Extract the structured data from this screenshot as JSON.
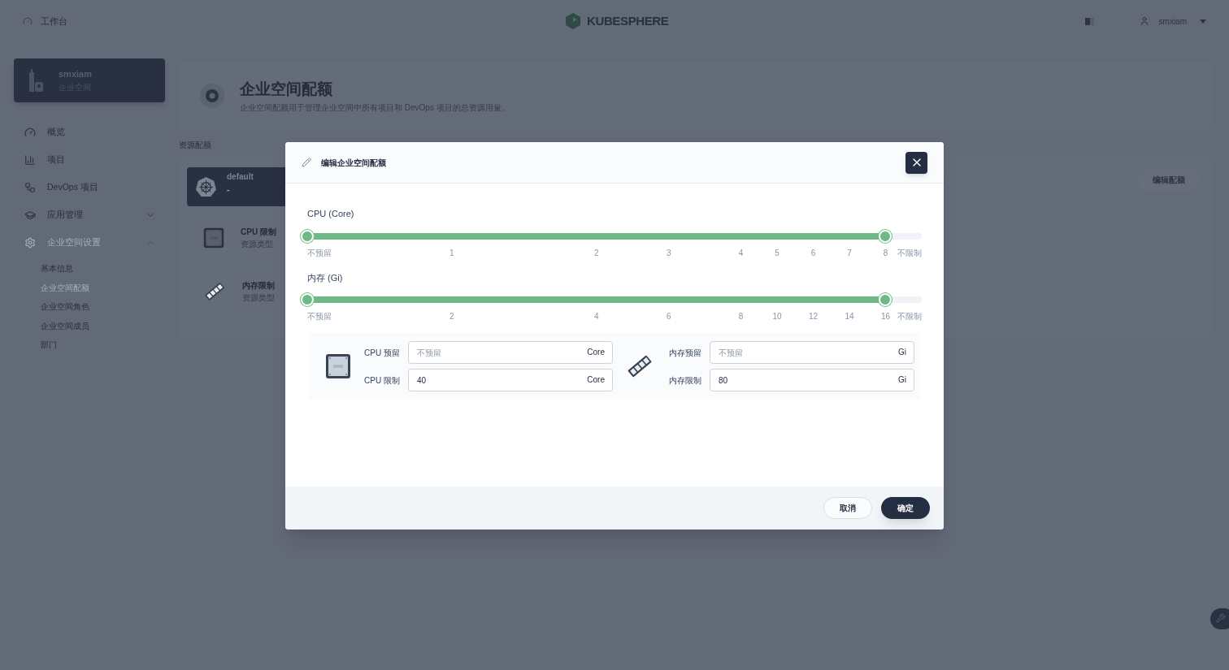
{
  "topbar": {
    "home": "工作台",
    "logo": "KUBESPHERE",
    "user": "smxiam"
  },
  "workspace": {
    "name": "smxiam",
    "type": "企业空间"
  },
  "nav": [
    {
      "label": "概览"
    },
    {
      "label": "项目"
    },
    {
      "label": "DevOps 项目"
    },
    {
      "label": "应用管理",
      "expanded": false
    },
    {
      "label": "企业空间设置",
      "expanded": true,
      "selected": true,
      "children": [
        {
          "label": "基本信息",
          "selected": false
        },
        {
          "label": "企业空间配额",
          "selected": true
        },
        {
          "label": "企业空间角色",
          "selected": false
        },
        {
          "label": "企业空间成员",
          "selected": false
        },
        {
          "label": "部门",
          "selected": false
        }
      ]
    }
  ],
  "page": {
    "title": "企业空间配额",
    "description": "企业空间配额用于管理企业空间中所有项目和 DevOps 项目的总资源用量。"
  },
  "quota": {
    "heading": "资源配额",
    "cluster": {
      "name": "default",
      "sub": "-"
    },
    "edit_button": "编辑配额",
    "rows": [
      {
        "kind": "cpu",
        "title": "CPU 限制",
        "sub": "资源类型"
      },
      {
        "kind": "memory",
        "title": "内存限制",
        "sub": "资源类型"
      }
    ]
  },
  "dialog": {
    "title": "编辑企业空间配额",
    "sliders": [
      {
        "label": "CPU (Core)",
        "ticks": [
          "不预留",
          "1",
          "2",
          "3",
          "4",
          "5",
          "6",
          "7",
          "8",
          "不限制"
        ],
        "thumbs": [
          {
            "level": 0
          },
          {
            "level": 0.941
          }
        ]
      },
      {
        "label": "内存 (Gi)",
        "ticks": [
          "不预留",
          "2",
          "4",
          "6",
          "8",
          "10",
          "12",
          "14",
          "16",
          "不限制"
        ],
        "thumbs": [
          {
            "level": 0
          },
          {
            "level": 0.941
          }
        ]
      }
    ],
    "groups": [
      {
        "kind": "cpu",
        "fields": [
          {
            "label": "CPU 预留",
            "placeholder": "不预留",
            "unit": "Core"
          },
          {
            "label": "CPU 限制",
            "value": "40",
            "unit": "Core"
          }
        ]
      },
      {
        "kind": "memory",
        "fields": [
          {
            "label": "内存预留",
            "placeholder": "不预留",
            "unit": "Gi"
          },
          {
            "label": "内存限制",
            "value": "80",
            "unit": "Gi"
          }
        ]
      }
    ],
    "buttons": [
      {
        "label": "取消",
        "kind": "secondary"
      },
      {
        "label": "确定",
        "kind": "primary"
      }
    ]
  }
}
